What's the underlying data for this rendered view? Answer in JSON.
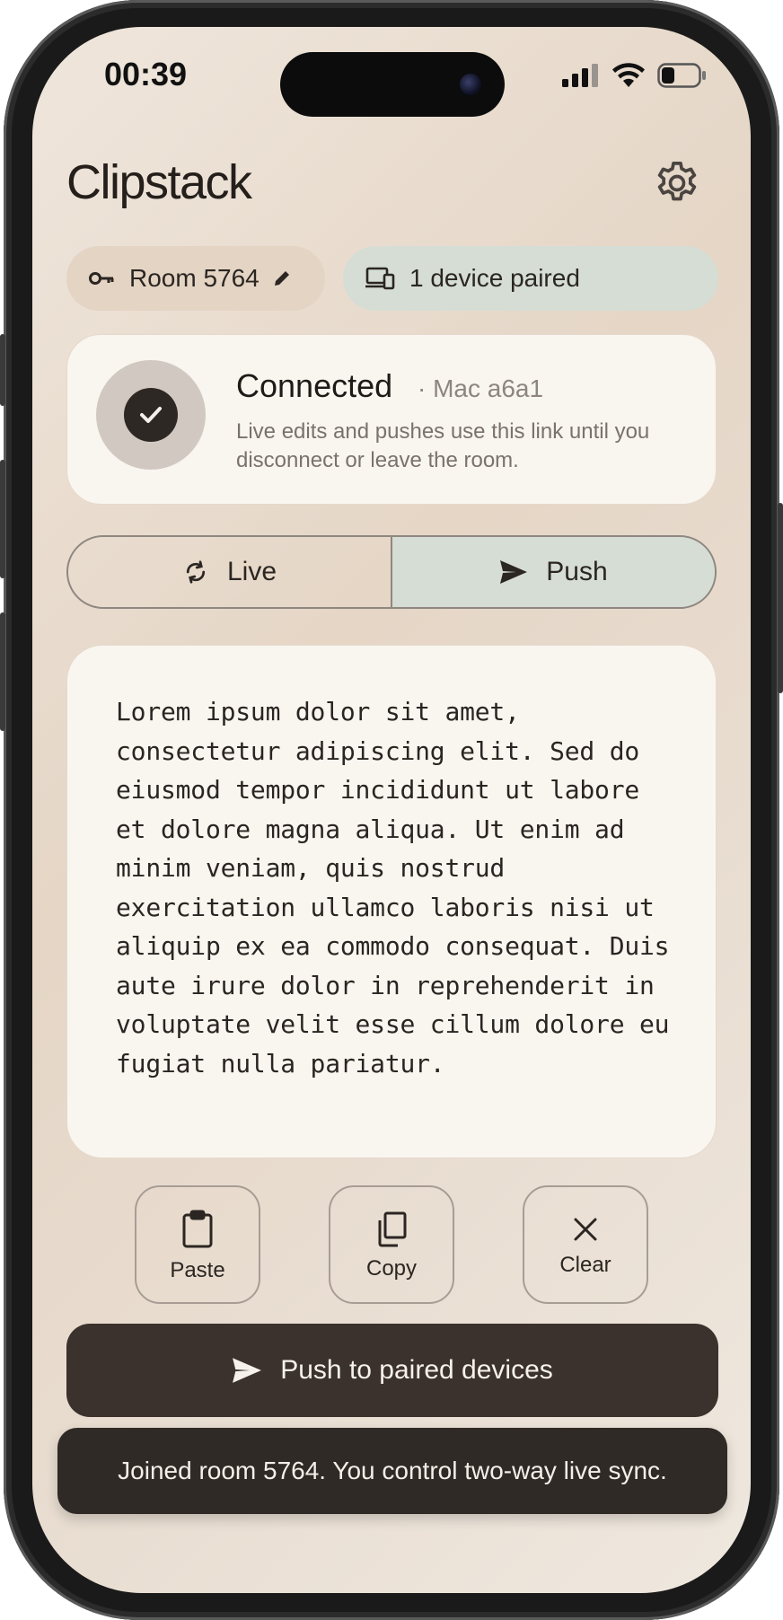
{
  "status_bar": {
    "time": "00:39",
    "icons": [
      "signal-icon",
      "wifi-icon",
      "battery-icon"
    ]
  },
  "header": {
    "title": "Clipstack",
    "settings_icon": "gear-icon"
  },
  "room_pill": {
    "label": "Room 5764",
    "icon": "key-icon",
    "edit_icon": "pencil-icon"
  },
  "devices_pill": {
    "label": "1 device paired",
    "icon": "devices-icon"
  },
  "connection": {
    "title": "Connected",
    "device": "· Mac a6a1",
    "description": "Live edits and pushes use this link until you disconnect or leave the room.",
    "icon": "check-icon"
  },
  "mode_toggle": {
    "live_label": "Live",
    "live_icon": "sync-icon",
    "push_label": "Push",
    "push_icon": "send-icon",
    "selected": "Push"
  },
  "editor": {
    "text": "Lorem ipsum dolor sit amet, consectetur adipiscing elit. Sed do eiusmod tempor incididunt ut labore et dolore magna aliqua. Ut enim ad minim veniam, quis nostrud exercitation ullamco laboris nisi ut aliquip ex ea commodo consequat. Duis aute irure dolor in reprehenderit in voluptate velit esse cillum dolore eu fugiat nulla pariatur."
  },
  "actions": {
    "paste_label": "Paste",
    "copy_label": "Copy",
    "clear_label": "Clear"
  },
  "push_button": {
    "label": "Push to paired devices",
    "icon": "send-icon"
  },
  "toast": {
    "message": "Joined room 5764. You control two-way live sync."
  },
  "colors": {
    "primary_dark": "#3b322d",
    "accent_sage": "#d5ddd5",
    "room_pill": "#e4d4c4",
    "card_bg": "#f9f6f0"
  }
}
